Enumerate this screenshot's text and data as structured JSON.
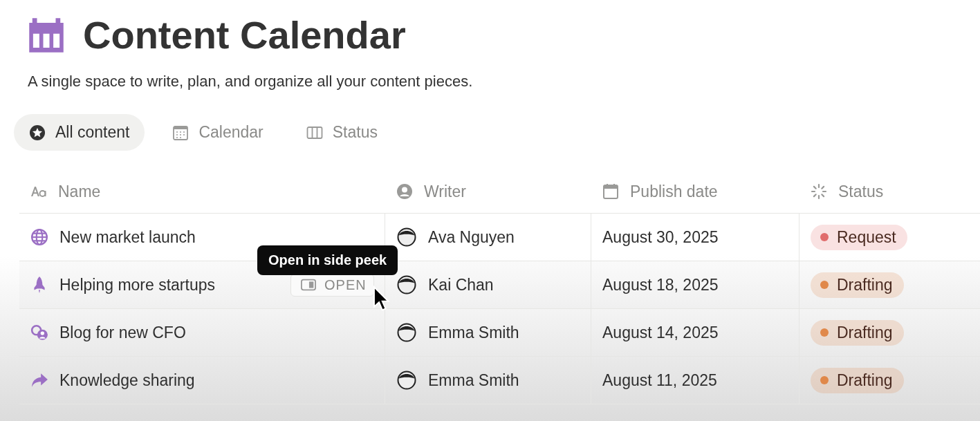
{
  "page": {
    "title": "Content Calendar",
    "description": "A single space to write, plan, and organize all your content pieces."
  },
  "views": [
    {
      "label": "All content",
      "selected": true
    },
    {
      "label": "Calendar",
      "selected": false
    },
    {
      "label": "Status",
      "selected": false
    }
  ],
  "table": {
    "columns": [
      {
        "label": "Name"
      },
      {
        "label": "Writer"
      },
      {
        "label": "Publish date"
      },
      {
        "label": "Status"
      }
    ],
    "rows": [
      {
        "name": "New market launch",
        "writer": "Ava Nguyen",
        "date": "August 30, 2025",
        "status": "Request",
        "color": "#e06c6c",
        "hovered": false
      },
      {
        "name": "Helping more startups",
        "writer": "Kai Chan",
        "date": "August 18, 2025",
        "status": "Drafting",
        "color": "#e0884a",
        "hovered": true
      },
      {
        "name": "Blog for new CFO",
        "writer": "Emma Smith",
        "date": "August 14, 2025",
        "status": "Drafting",
        "color": "#e0884a",
        "hovered": false
      },
      {
        "name": "Knowledge sharing",
        "writer": "Emma Smith",
        "date": "August 11, 2025",
        "status": "Drafting",
        "color": "#e0884a",
        "hovered": false
      }
    ]
  },
  "open_button": {
    "label": "OPEN"
  },
  "tooltip": {
    "text": "Open in side peek"
  }
}
